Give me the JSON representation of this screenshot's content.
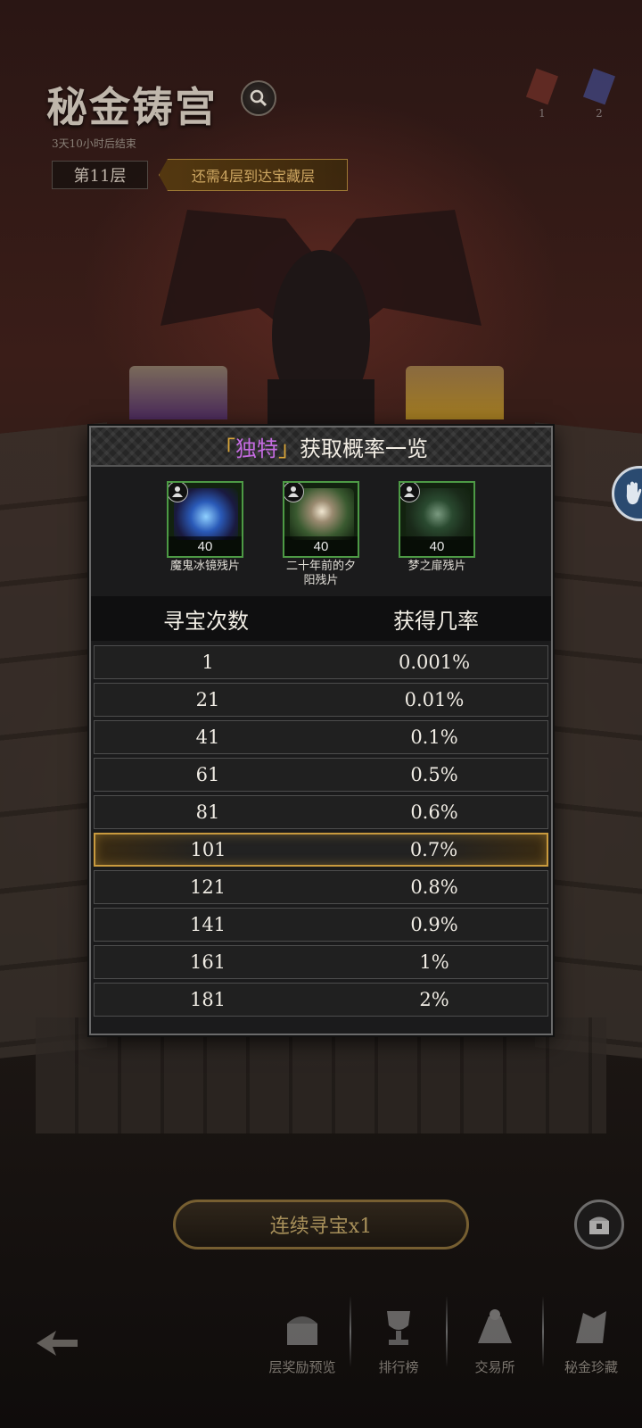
{
  "header": {
    "title": "秘金铸宫",
    "subtitle": "3天10小时后结束",
    "floor": "第11层",
    "floor_tip": "还需4层到达宝藏层"
  },
  "top_resources": [
    {
      "icon": "red-crystal-icon",
      "value": "1"
    },
    {
      "icon": "blue-crystal-icon",
      "value": "2"
    }
  ],
  "modal": {
    "title_bracket_open": "「",
    "title_accent": "独特",
    "title_bracket_close": "」",
    "title_rest": "获取概率一览",
    "items": [
      {
        "name": "魔鬼冰镜残片",
        "count": "40",
        "icon": "ice-mirror-fragment-icon"
      },
      {
        "name": "二十年前的夕阳残片",
        "count": "40",
        "icon": "sunset-fragment-icon"
      },
      {
        "name": "梦之扉残片",
        "count": "40",
        "icon": "dream-door-fragment-icon"
      }
    ],
    "table": {
      "col1": "寻宝次数",
      "col2": "获得几率",
      "rows": [
        {
          "count": "1",
          "rate": "0.001%"
        },
        {
          "count": "21",
          "rate": "0.01%"
        },
        {
          "count": "41",
          "rate": "0.1%"
        },
        {
          "count": "61",
          "rate": "0.5%"
        },
        {
          "count": "81",
          "rate": "0.6%"
        },
        {
          "count": "101",
          "rate": "0.7%"
        },
        {
          "count": "121",
          "rate": "0.8%"
        },
        {
          "count": "141",
          "rate": "0.9%"
        },
        {
          "count": "161",
          "rate": "1%"
        },
        {
          "count": "181",
          "rate": "2%"
        }
      ],
      "highlighted_row": "101"
    }
  },
  "bottom": {
    "explore_button": "连续寻宝x1",
    "nav": [
      {
        "label": "层奖励预览",
        "icon": "reward-chest-icon"
      },
      {
        "label": "排行榜",
        "icon": "trophy-icon"
      },
      {
        "label": "交易所",
        "icon": "exchange-icon"
      },
      {
        "label": "秘金珍藏",
        "icon": "treasure-icon"
      }
    ]
  },
  "colors": {
    "accent_purple": "#c46be0",
    "highlight_gold": "#c99a3e",
    "item_border_green": "#4d9a45"
  }
}
